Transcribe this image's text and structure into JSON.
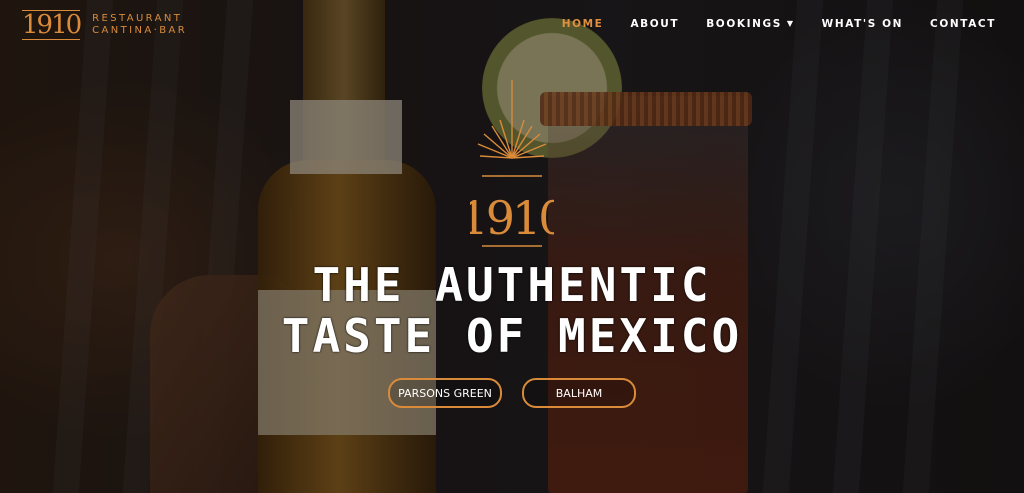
{
  "brand": {
    "mark": "1910",
    "line1": "RESTAURANT",
    "line2": "CANTINA·BAR"
  },
  "nav": {
    "items": [
      {
        "label": "HOME",
        "active": true
      },
      {
        "label": "ABOUT",
        "active": false
      },
      {
        "label": "BOOKINGS",
        "active": false,
        "has_dropdown": true
      },
      {
        "label": "WHAT'S ON",
        "active": false
      },
      {
        "label": "CONTACT",
        "active": false
      }
    ]
  },
  "hero": {
    "emblem_text": "1910",
    "headline_line1": "THE AUTHENTIC",
    "headline_line2": "TASTE OF MEXICO",
    "buttons": [
      {
        "label": "PARSONS GREEN"
      },
      {
        "label": "BALHAM"
      }
    ]
  },
  "colors": {
    "accent": "#d98b3a",
    "text": "#ffffff"
  },
  "icons": {
    "dropdown": "chevron-down-icon",
    "emblem_rays": "sunburst-icon"
  }
}
